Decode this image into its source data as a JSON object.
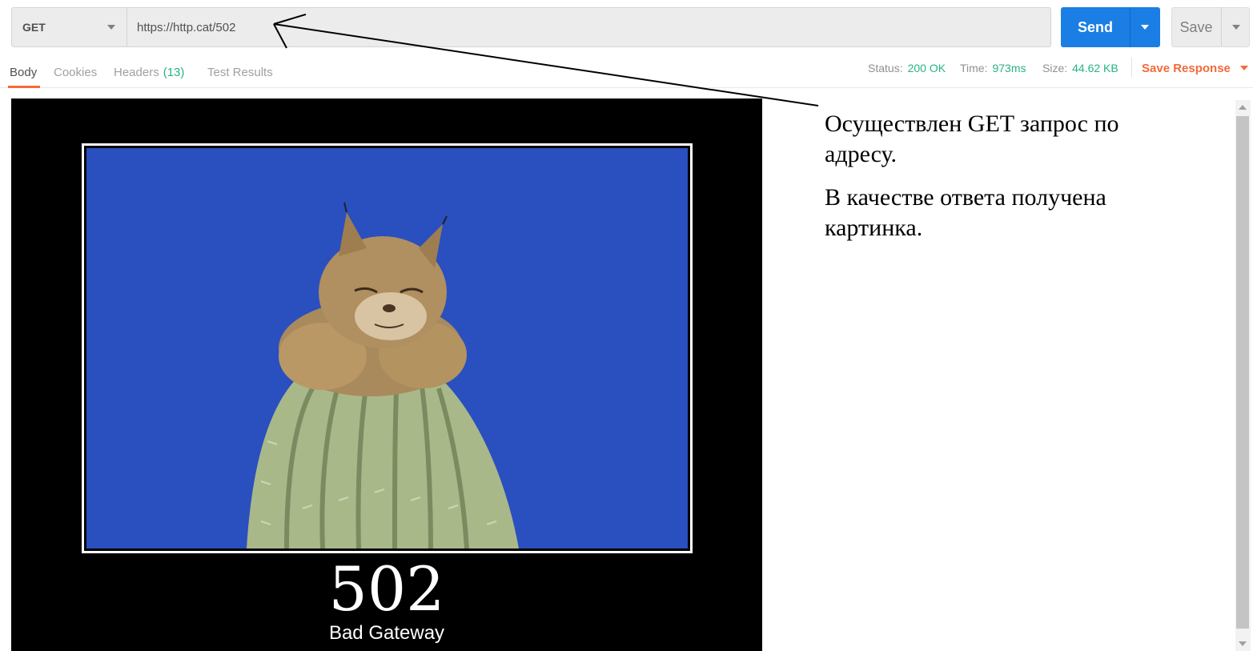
{
  "request": {
    "method": "GET",
    "url": "https://http.cat/502",
    "send_label": "Send",
    "save_label": "Save"
  },
  "response": {
    "tabs": [
      {
        "label": "Body",
        "active": true
      },
      {
        "label": "Cookies"
      },
      {
        "label": "Headers",
        "count": "(13)"
      },
      {
        "label": "Test Results"
      }
    ],
    "status_label": "Status:",
    "status_value": "200 OK",
    "time_label": "Time:",
    "time_value": "973ms",
    "size_label": "Size:",
    "size_value": "44.62 KB",
    "save_response_label": "Save Response"
  },
  "image": {
    "code": "502",
    "subtitle": "Bad Gateway"
  },
  "annotation": {
    "line1": "Осуществлен GET запрос по адресу.",
    "line2": "В качестве ответа получена картинка."
  },
  "colors": {
    "accent_blue": "#1b7ee5",
    "tab_accent": "#f26b3a",
    "status_green": "#26b47f",
    "sky": "#2a4fbf"
  }
}
